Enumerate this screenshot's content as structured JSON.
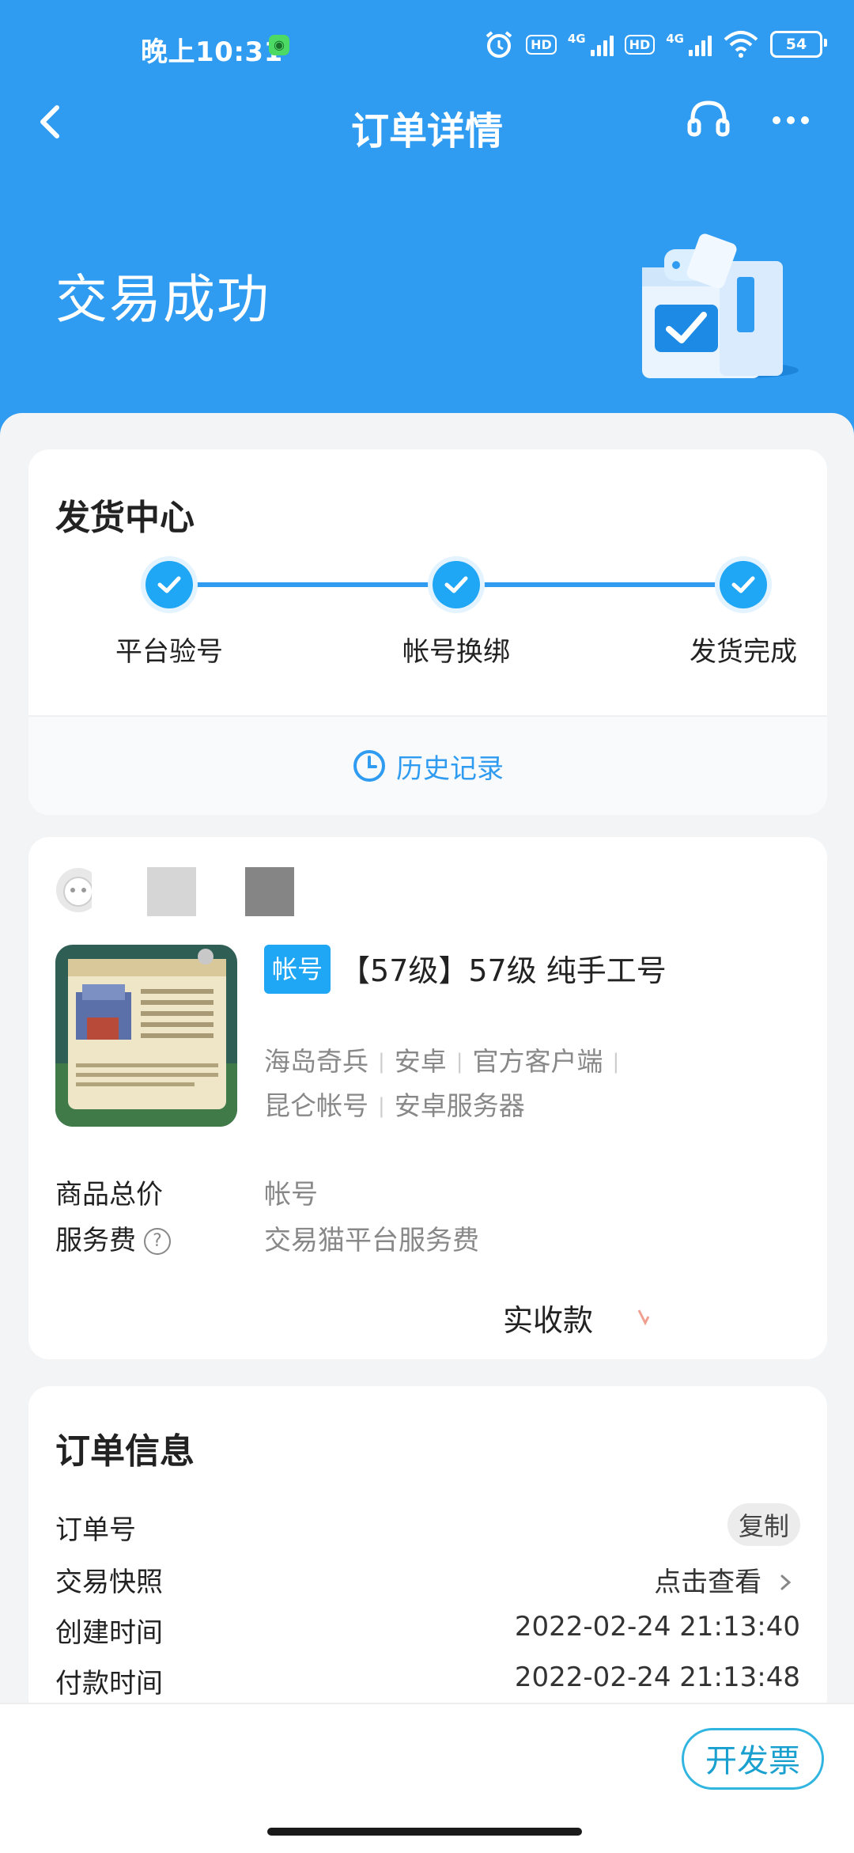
{
  "status_bar": {
    "time": "晚上10:31",
    "hd1": "HD",
    "net1": "4G",
    "hd2": "HD",
    "net2": "4G",
    "battery": "54"
  },
  "nav": {
    "title": "订单详情"
  },
  "hero": {
    "title": "交易成功"
  },
  "delivery": {
    "title": "发货中心",
    "steps": [
      {
        "label": "平台验号"
      },
      {
        "label": "帐号换绑"
      },
      {
        "label": "发货完成"
      }
    ],
    "history_label": "历史记录"
  },
  "product": {
    "tag": "帐号",
    "title": "【57级】57级 纯手工号",
    "meta": [
      "海岛奇兵",
      "安卓",
      "官方客户端",
      "昆仑帐号",
      "安卓服务器"
    ],
    "total_price_label": "商品总价",
    "total_price_value": "帐号",
    "service_fee_label": "服务费",
    "service_fee_value": "交易猫平台服务费",
    "received_label": "实收款"
  },
  "order_info": {
    "title": "订单信息",
    "order_no_label": "订单号",
    "copy_label": "复制",
    "snapshot_label": "交易快照",
    "snapshot_value": "点击查看",
    "created_label": "创建时间",
    "created_value": "2022-02-24 21:13:40",
    "paid_label": "付款时间",
    "paid_value": "2022-02-24 21:13:48"
  },
  "bottom": {
    "invoice_label": "开发票"
  },
  "colors": {
    "primary": "#2f9cf2",
    "step": "#1fa6f5",
    "invoice": "#1aa0cf"
  }
}
